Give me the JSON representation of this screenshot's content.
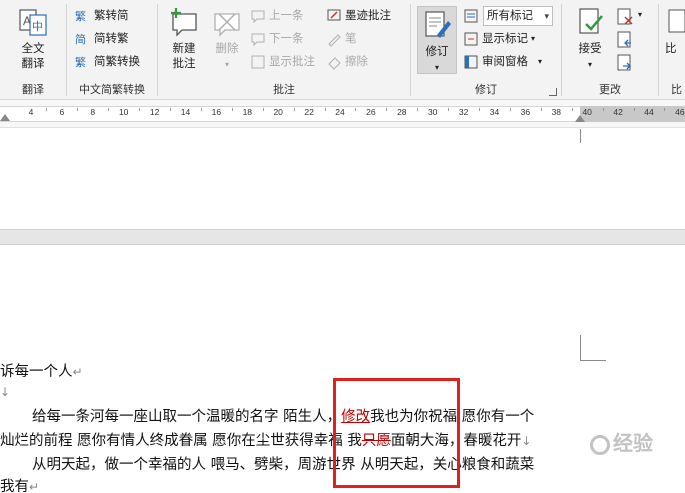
{
  "ribbon": {
    "translate_group": {
      "label": "翻译",
      "full_translate": "全文\n翻译"
    },
    "chinese_convert_group": {
      "label": "中文简繁转换",
      "to_simplified": "繁转简",
      "to_traditional": "简转繁",
      "convert": "简繁转换"
    },
    "comments_group": {
      "label": "批注",
      "new_comment": "新建\n批注",
      "delete": "删除",
      "previous": "上一条",
      "next": "下一条",
      "show_comments": "显示批注",
      "ink_comment": "墨迹批注",
      "pen": "笔",
      "eraser": "擦除"
    },
    "tracking_group": {
      "label": "修订",
      "track_changes": "修订",
      "markup_select": "所有标记",
      "show_markup": "显示标记",
      "reviewing_pane": "审阅窗格"
    },
    "changes_group": {
      "label": "更改",
      "accept": "接受"
    },
    "compare_group": {
      "label": "比",
      "compare": "比"
    }
  },
  "ruler": {
    "ticks": [
      "4",
      "6",
      "8",
      "10",
      "12",
      "14",
      "16",
      "18",
      "20",
      "22",
      "24",
      "26",
      "28",
      "30",
      "32",
      "34",
      "36",
      "38",
      "40",
      "42",
      "44",
      "46"
    ]
  },
  "document": {
    "line1": "诉每一个人",
    "line3": "给每一条河每一座山取一个温暖的名字  陌生人，",
    "inserted": "修改",
    "line3_rest": "我也为你祝福  愿你有一个",
    "line4": "灿烂的前程  愿你有情人终成眷属  愿你在尘世获得幸福  我",
    "deleted": "只愿",
    "line4_rest": "面朝大海，春暖花开",
    "line5": "从明天起，做一个幸福的人  喂马、劈柴，周游世界  从明天起，关心粮食和蔬菜",
    "line6": "我有"
  },
  "watermark": "经验"
}
